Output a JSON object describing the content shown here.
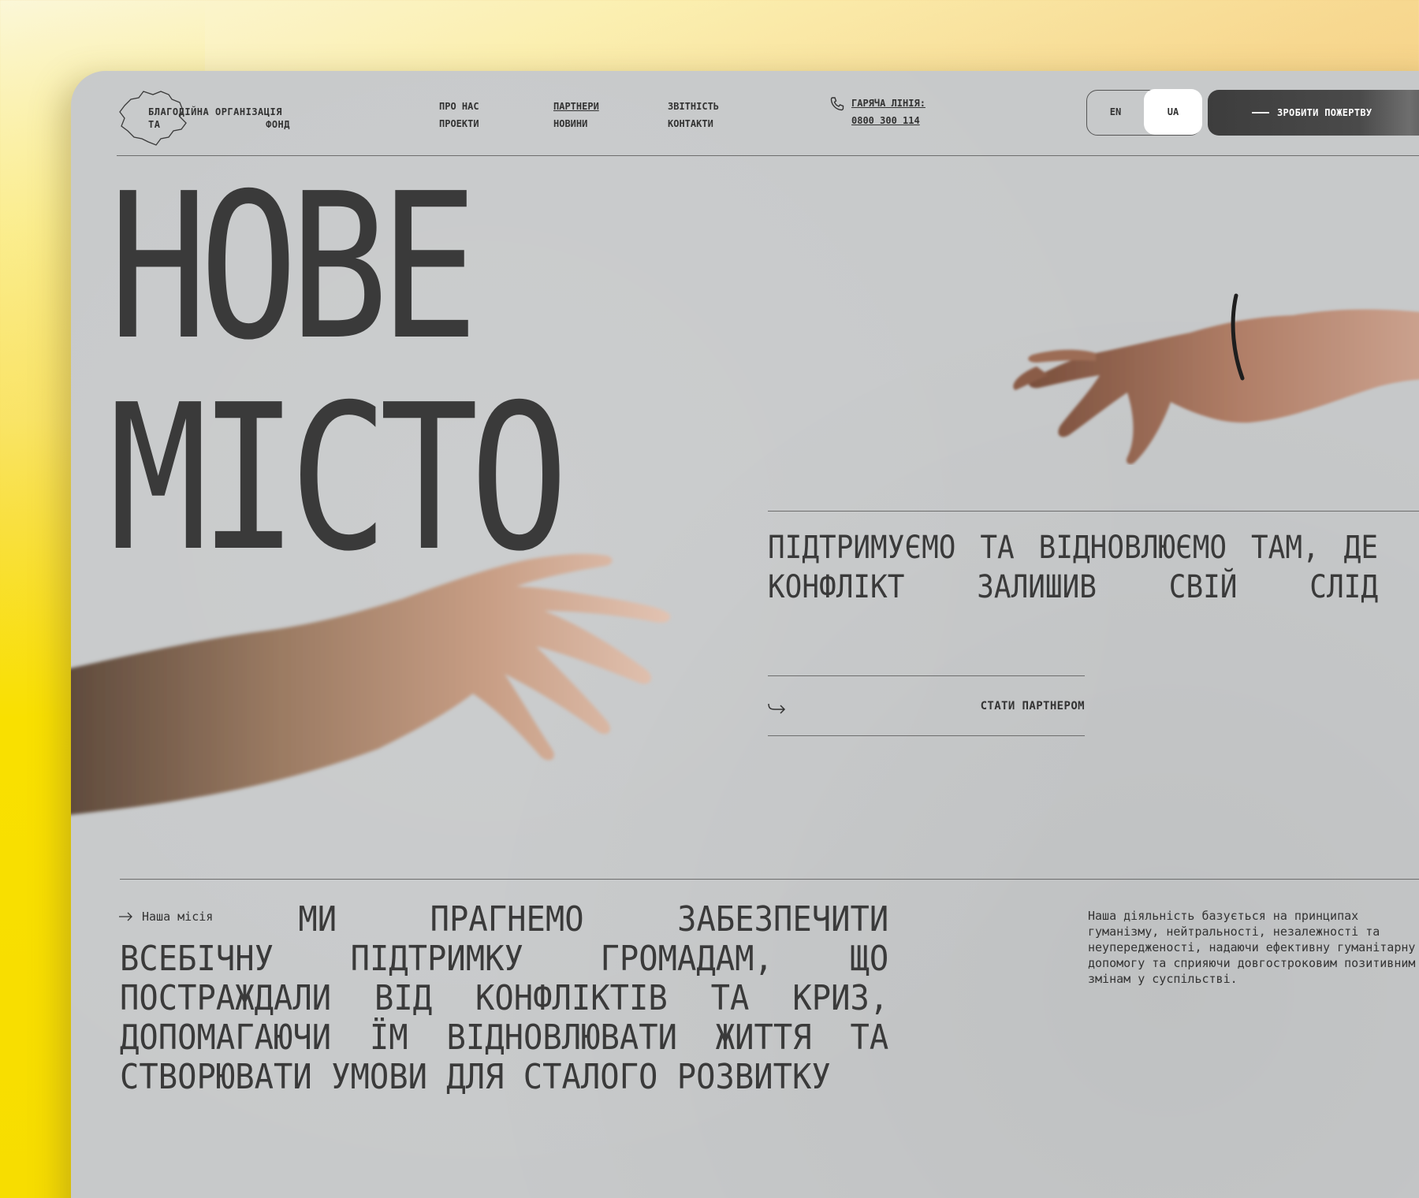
{
  "logo": {
    "line1": "БЛАГОДІЙНА ОРГАНІЗАЦІЯ",
    "line2_left": "ТА",
    "line2_right": "ФОНД"
  },
  "nav": {
    "col1": [
      "ПРО НАС",
      "ПРОЕКТИ"
    ],
    "col2": [
      "ПАРТНЕРИ",
      "НОВИНИ"
    ],
    "col3": [
      "ЗВІТНІСТЬ",
      "КОНТАКТИ"
    ]
  },
  "hotline": {
    "label": "ГАРЯЧА ЛІНІЯ:",
    "number": "0800 300 114"
  },
  "language": {
    "options": [
      "EN",
      "UA"
    ],
    "selected": "UA"
  },
  "donate": {
    "label": "ЗРОБИТИ ПОЖЕРТВУ"
  },
  "hero": {
    "title_line1": "НОВЕ",
    "title_line2": "МІСТО",
    "tagline": "ПІДТРИМУЄМО ТА ВІДНОВЛЮЄМО ТАМ, ДЕ КОНФЛІКТ ЗАЛИШИВ СВІЙ СЛІД",
    "partner_cta": "СТАТИ ПАРТНЕРОМ"
  },
  "mission": {
    "label": "Наша місія",
    "text": "МИ ПРАГНЕМО ЗАБЕЗПЕЧИТИ ВСЕБІЧНУ ПІДТРИМКУ ГРОМАДАМ, ЩО ПОСТРАЖДАЛИ ВІД КОНФЛІКТІВ ТА КРИЗ, ДОПОМАГАЮЧИ ЇМ ВІДНОВЛЮВАТИ ЖИТТЯ ТА СТВОРЮВАТИ УМОВИ ДЛЯ СТАЛОГО РОЗВИТКУ",
    "principles": "Наша діяльність базується на принципах гуманізму, нейтральності, незалежності та неупередженості, надаючи ефективну гуманітарну допомогу та сприяючи довгостроковим позитивним змінам у суспільстві."
  }
}
